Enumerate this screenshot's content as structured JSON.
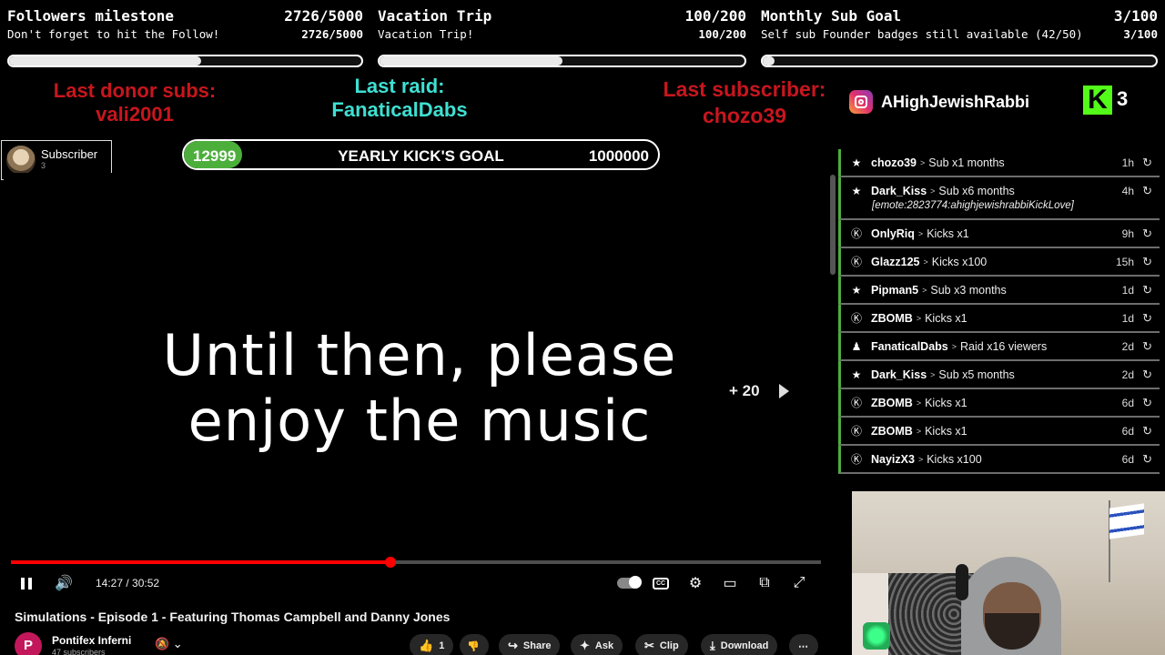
{
  "goals": [
    {
      "title": "Followers milestone",
      "subtitle": "Don't forget to hit the Follow!",
      "count": "2726/5000",
      "count2": "2726/5000",
      "progress": 0.545
    },
    {
      "title": "Vacation Trip",
      "subtitle": "Vacation Trip!",
      "count": "100/200",
      "count2": "100/200",
      "progress": 0.5
    },
    {
      "title": "Monthly Sub Goal",
      "subtitle": "Self sub Founder badges still available (42/50)",
      "count": "3/100",
      "count2": "3/100",
      "progress": 0.03
    }
  ],
  "last_donor": {
    "label": "Last donor subs:",
    "value": "vali2001"
  },
  "last_raid": {
    "label": "Last raid:",
    "value": "FanaticalDabs"
  },
  "last_subscriber": {
    "label": "Last subscriber:",
    "value": "chozo39"
  },
  "social": {
    "instagram": "AHighJewishRabbi",
    "kick_count": "3",
    "kick_logo": "K"
  },
  "subscriber_box": {
    "label": "Subscriber",
    "count": "3"
  },
  "yearly_goal": {
    "current": "12999",
    "label": "YEARLY KICK'S GOAL",
    "target": "1000000",
    "progress": 0.013
  },
  "player": {
    "caption_line1": "Until then, please",
    "caption_line2": "enjoy the music",
    "seek_hint": "+ 20",
    "time": "14:27 / 30:52",
    "progress": 0.468
  },
  "video": {
    "title": "Simulations - Episode 1 - Featuring Thomas Campbell and Danny Jones",
    "channel": "Pontifex Inferni",
    "channel_initial": "P",
    "subscribers": "47 subscribers",
    "likes": "1",
    "share": "Share",
    "ask": "Ask",
    "clip": "Clip",
    "download": "Download"
  },
  "events": [
    {
      "icon": "star-icon",
      "glyph": "★",
      "user": "chozo39",
      "action": "Sub x1 months",
      "time": "1h"
    },
    {
      "icon": "star-icon",
      "glyph": "★",
      "user": "Dark_Kiss",
      "action": "Sub x6 months",
      "time": "4h",
      "message": "[emote:2823774:ahighjewishrabbiKickLove]"
    },
    {
      "icon": "kick-icon",
      "glyph": "Ⓚ",
      "user": "OnlyRiq",
      "action": "Kicks x1",
      "time": "9h"
    },
    {
      "icon": "kick-icon",
      "glyph": "Ⓚ",
      "user": "Glazz125",
      "action": "Kicks x100",
      "time": "15h"
    },
    {
      "icon": "star-icon",
      "glyph": "★",
      "user": "Pipman5",
      "action": "Sub x3 months",
      "time": "1d"
    },
    {
      "icon": "kick-icon",
      "glyph": "Ⓚ",
      "user": "ZBOMB",
      "action": "Kicks x1",
      "time": "1d"
    },
    {
      "icon": "raid-icon",
      "glyph": "♟",
      "user": "FanaticalDabs",
      "action": "Raid x16 viewers",
      "time": "2d"
    },
    {
      "icon": "star-icon",
      "glyph": "★",
      "user": "Dark_Kiss",
      "action": "Sub x5 months",
      "time": "2d"
    },
    {
      "icon": "kick-icon",
      "glyph": "Ⓚ",
      "user": "ZBOMB",
      "action": "Kicks x1",
      "time": "6d"
    },
    {
      "icon": "kick-icon",
      "glyph": "Ⓚ",
      "user": "ZBOMB",
      "action": "Kicks x1",
      "time": "6d"
    },
    {
      "icon": "kick-icon",
      "glyph": "Ⓚ",
      "user": "NayizX3",
      "action": "Kicks x100",
      "time": "6d"
    }
  ],
  "colors": {
    "kick_green": "#53fc18",
    "goal_green": "#4caf3c",
    "progress_red": "#ff0000",
    "donor_red": "#c8161d",
    "raid_cyan": "#3ee0d2"
  }
}
